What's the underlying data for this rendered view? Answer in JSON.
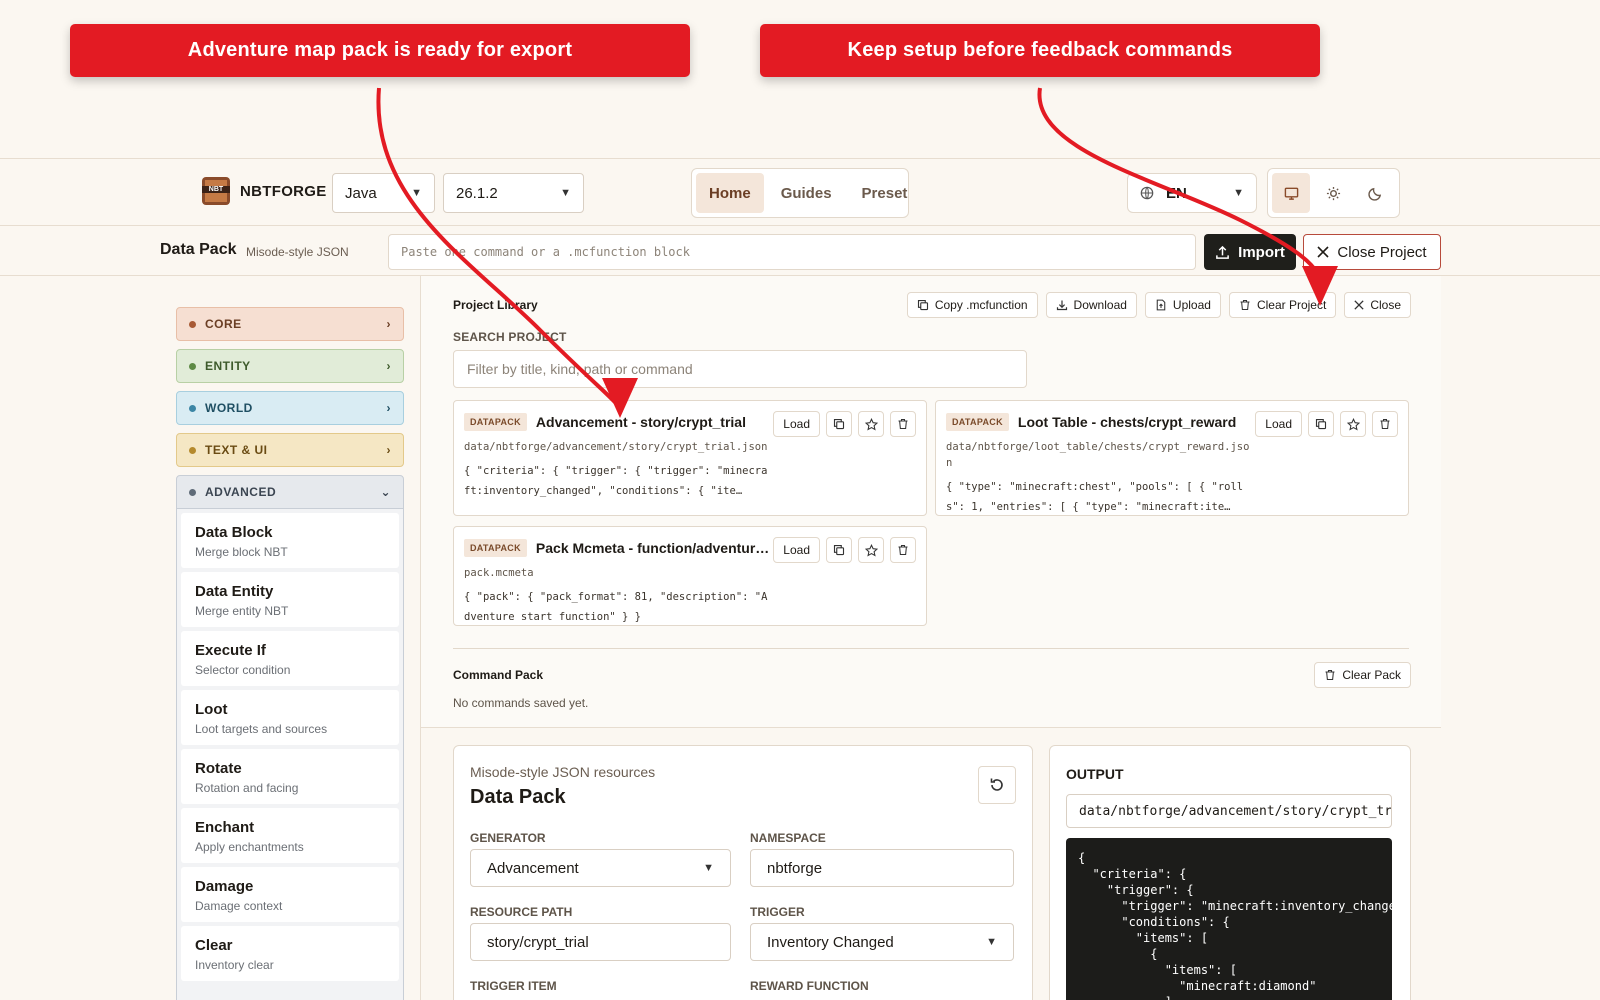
{
  "callouts": {
    "left": "Adventure map pack is ready for export",
    "right": "Keep setup before feedback commands"
  },
  "topbar": {
    "brand": "NBTFORGE",
    "logo_text": "NBT",
    "edition": "Java",
    "version": "26.1.2",
    "nav": [
      "Home",
      "Guides",
      "Preset"
    ],
    "nav_active": "Home",
    "language": "EN"
  },
  "bar2": {
    "title": "Data Pack",
    "subtitle": "Misode-style JSON",
    "command_placeholder": "Paste one command or a .mcfunction block",
    "import_label": "Import",
    "close_project_label": "Close Project"
  },
  "sidebar": {
    "categories": [
      {
        "label": "CORE"
      },
      {
        "label": "ENTITY"
      },
      {
        "label": "WORLD"
      },
      {
        "label": "TEXT & UI"
      }
    ],
    "advanced_label": "ADVANCED",
    "advanced_items": [
      {
        "title": "Data Block",
        "sub": "Merge block NBT"
      },
      {
        "title": "Data Entity",
        "sub": "Merge entity NBT"
      },
      {
        "title": "Execute If",
        "sub": "Selector condition"
      },
      {
        "title": "Loot",
        "sub": "Loot targets and sources"
      },
      {
        "title": "Rotate",
        "sub": "Rotation and facing"
      },
      {
        "title": "Enchant",
        "sub": "Apply enchantments"
      },
      {
        "title": "Damage",
        "sub": "Damage context"
      },
      {
        "title": "Clear",
        "sub": "Inventory clear"
      }
    ]
  },
  "library": {
    "title": "Project Library",
    "actions": [
      "Copy .mcfunction",
      "Download",
      "Upload",
      "Clear Project",
      "Close"
    ],
    "search_label": "SEARCH PROJECT",
    "search_placeholder": "Filter by title, kind, path or command",
    "load_label": "Load",
    "cards": [
      {
        "kind": "DATAPACK",
        "title": "Advancement - story/crypt_trial",
        "path": "data/nbtforge/advancement/story/crypt_trial.json",
        "code": "{ \"criteria\": { \"trigger\": { \"trigger\": \"minecraft:inventory_changed\", \"conditions\": { \"ite…"
      },
      {
        "kind": "DATAPACK",
        "title": "Loot Table - chests/crypt_reward",
        "path": "data/nbtforge/loot_table/chests/crypt_reward.json",
        "code": "{ \"type\": \"minecraft:chest\", \"pools\": [ { \"rolls\": 1, \"entries\": [ { \"type\": \"minecraft:ite…"
      },
      {
        "kind": "DATAPACK",
        "title": "Pack Mcmeta - function/adventure_start",
        "path": "pack.mcmeta",
        "code": "{ \"pack\": { \"pack_format\": 81, \"description\": \"Adventure start function\" } }"
      }
    ],
    "command_pack_title": "Command Pack",
    "command_pack_empty": "No commands saved yet.",
    "clear_pack_label": "Clear Pack"
  },
  "editor": {
    "subtitle": "Misode-style JSON resources",
    "title": "Data Pack",
    "fields": {
      "generator_label": "GENERATOR",
      "generator_value": "Advancement",
      "namespace_label": "NAMESPACE",
      "namespace_value": "nbtforge",
      "resource_path_label": "RESOURCE PATH",
      "resource_path_value": "story/crypt_trial",
      "trigger_label": "TRIGGER",
      "trigger_value": "Inventory Changed",
      "trigger_item_label": "TRIGGER ITEM",
      "reward_function_label": "REWARD FUNCTION"
    }
  },
  "output": {
    "title": "OUTPUT",
    "path": "data/nbtforge/advancement/story/crypt_trial.json",
    "code": "{\n  \"criteria\": {\n    \"trigger\": {\n      \"trigger\": \"minecraft:inventory_changed\",\n      \"conditions\": {\n        \"items\": [\n          {\n            \"items\": [\n              \"minecraft:diamond\"\n            ]"
  },
  "colors": {
    "accent_red": "#e31b23",
    "accent_brown": "#8a4b2a",
    "background": "#fbf7f1"
  }
}
